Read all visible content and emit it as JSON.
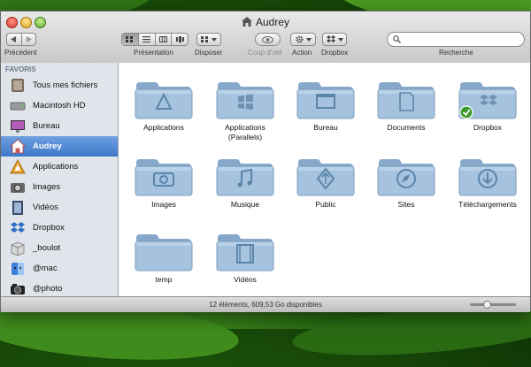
{
  "window": {
    "title": "Audrey"
  },
  "toolbar": {
    "back_label": "Précédent",
    "view_label": "Présentation",
    "arrange_label": "Disposer",
    "quicklook_label": "Coup d’œil",
    "action_label": "Action",
    "dropbox_label": "Dropbox",
    "search_label": "Recherche",
    "search_placeholder": ""
  },
  "sidebar": {
    "heading": "FAVORIS",
    "items": [
      {
        "label": "Tous mes fichiers",
        "icon": "all-files-icon"
      },
      {
        "label": "Macintosh HD",
        "icon": "hard-drive-icon"
      },
      {
        "label": "Bureau",
        "icon": "desktop-icon"
      },
      {
        "label": "Audrey",
        "icon": "home-icon",
        "selected": true
      },
      {
        "label": "Applications",
        "icon": "applications-icon"
      },
      {
        "label": "Images",
        "icon": "camera-icon"
      },
      {
        "label": "Vidéos",
        "icon": "film-icon"
      },
      {
        "label": "Dropbox",
        "icon": "dropbox-icon"
      },
      {
        "label": "_boulot",
        "icon": "box-icon"
      },
      {
        "label": "@mac",
        "icon": "finder-icon"
      },
      {
        "label": "@photo",
        "icon": "photo-camera-icon"
      }
    ]
  },
  "folders": [
    {
      "label": "Applications",
      "emblem": "applications"
    },
    {
      "label": "Applications (Parallels)",
      "emblem": "windows"
    },
    {
      "label": "Bureau",
      "emblem": "desktop"
    },
    {
      "label": "Documents",
      "emblem": "document"
    },
    {
      "label": "Dropbox",
      "emblem": "dropbox"
    },
    {
      "label": "Images",
      "emblem": "camera"
    },
    {
      "label": "Musique",
      "emblem": "music"
    },
    {
      "label": "Public",
      "emblem": "public"
    },
    {
      "label": "Sites",
      "emblem": "compass"
    },
    {
      "label": "Téléchargements",
      "emblem": "download"
    },
    {
      "label": "temp",
      "emblem": "none"
    },
    {
      "label": "Vidéos",
      "emblem": "film"
    }
  ],
  "status": {
    "text": "12 éléments, 609,53 Go disponibles"
  },
  "colors": {
    "selection": "#3c78c9",
    "folder": "#9fbfdc",
    "sidebar_bg": "#e0e5ec"
  }
}
